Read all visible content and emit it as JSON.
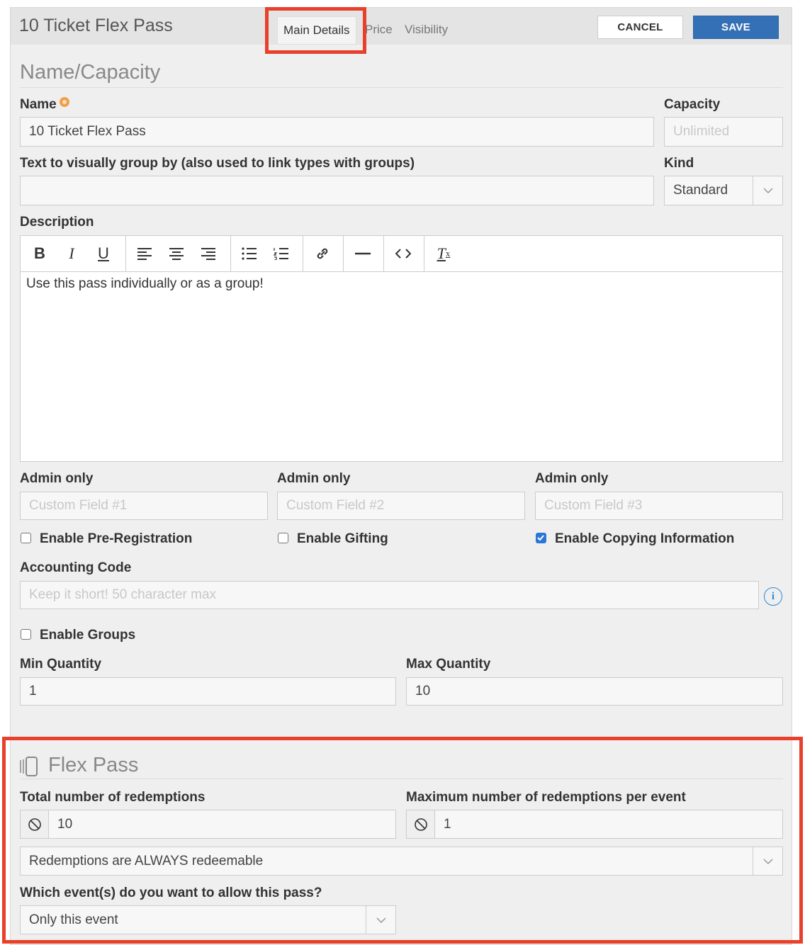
{
  "header": {
    "title": "10 Ticket Flex Pass",
    "tabs": [
      {
        "label": "Main Details"
      },
      {
        "label": "Price"
      },
      {
        "label": "Visibility"
      }
    ],
    "cancel_label": "CANCEL",
    "save_label": "SAVE"
  },
  "name_capacity": {
    "section_title": "Name/Capacity",
    "name_label": "Name",
    "name_value": "10 Ticket Flex Pass",
    "capacity_label": "Capacity",
    "capacity_placeholder": "Unlimited",
    "group_label": "Text to visually group by (also used to link types with groups)",
    "group_value": "",
    "kind_label": "Kind",
    "kind_value": "Standard",
    "description_label": "Description",
    "description_text": "Use this pass individually or as a group!",
    "toolbar_icons": [
      "bold-icon",
      "italic-icon",
      "underline-icon",
      "align-left-icon",
      "align-center-icon",
      "align-right-icon",
      "bullet-list-icon",
      "numbered-list-icon",
      "link-icon",
      "horizontal-rule-icon",
      "code-icon",
      "clear-format-icon"
    ],
    "custom_fields": [
      {
        "label": "Admin only",
        "placeholder": "Custom Field #1"
      },
      {
        "label": "Admin only",
        "placeholder": "Custom Field #2"
      },
      {
        "label": "Admin only",
        "placeholder": "Custom Field #3"
      }
    ],
    "checkboxes": [
      {
        "label": "Enable Pre-Registration",
        "checked": false
      },
      {
        "label": "Enable Gifting",
        "checked": false
      },
      {
        "label": "Enable Copying Information",
        "checked": true
      }
    ],
    "accounting_label": "Accounting Code",
    "accounting_placeholder": "Keep it short! 50 character max",
    "enable_groups_label": "Enable Groups",
    "enable_groups_checked": false,
    "min_qty_label": "Min Quantity",
    "min_qty_value": "1",
    "max_qty_label": "Max Quantity",
    "max_qty_value": "10"
  },
  "flex_pass": {
    "section_title": "Flex Pass",
    "total_label": "Total number of redemptions",
    "total_value": "10",
    "max_per_event_label": "Maximum number of redemptions per event",
    "max_per_event_value": "1",
    "redeemable_value": "Redemptions are ALWAYS redeemable",
    "events_label": "Which event(s) do you want to allow this pass?",
    "events_value": "Only this event"
  },
  "colors": {
    "accent": "#3470b6",
    "highlight": "#e8402a",
    "required": "#f0a04a",
    "checkbox": "#2b76d6"
  }
}
